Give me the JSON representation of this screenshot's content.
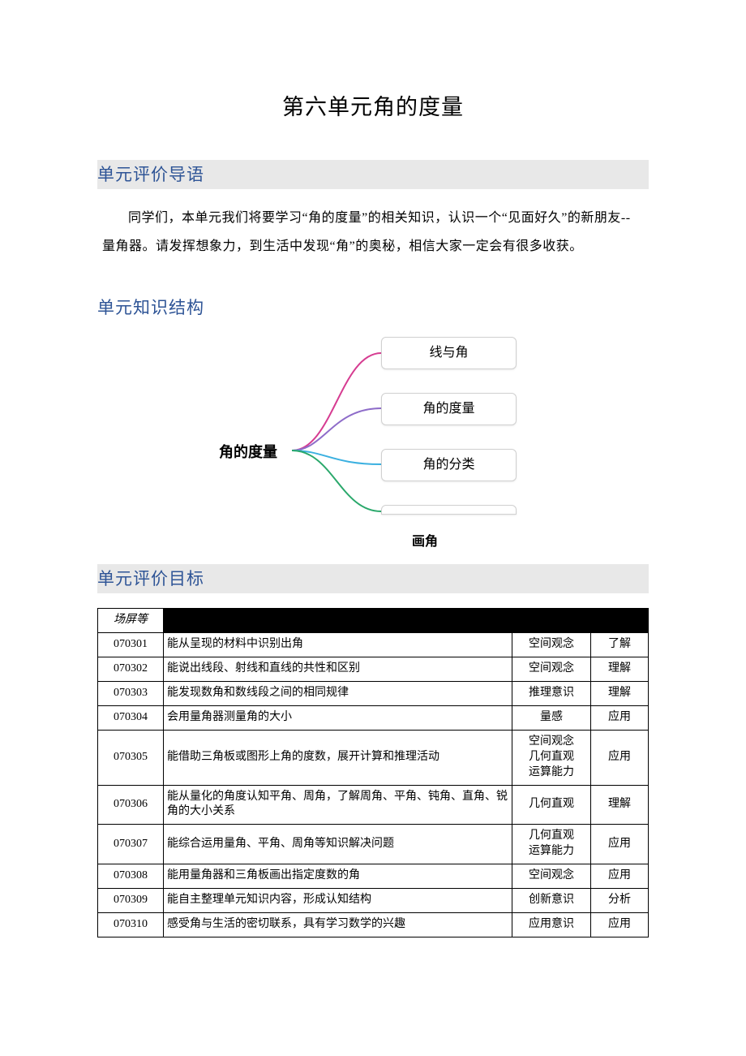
{
  "title": "第六单元角的度量",
  "sections": {
    "s1": {
      "heading": "单元评价导语"
    },
    "s2": {
      "heading": "单元知识结构"
    },
    "s3": {
      "heading": "单元评价目标"
    }
  },
  "intro": "同学们，本单元我们将要学习“角的度量”的相关知识，认识一个“见面好久”的新朋友--量角器。请发挥想象力，到生活中发现“角”的奥秘，相信大家一定会有很多收获。",
  "diagram": {
    "central": "角的度量",
    "nodes": [
      "线与角",
      "角的度量",
      "角的分类",
      "画角"
    ]
  },
  "table": {
    "headers": {
      "col1": "场屏等",
      "col2": "",
      "col3": "",
      "col4": ""
    },
    "rows": [
      {
        "code": "070301",
        "desc": "能从呈现的材料中识别出角",
        "cat": "空间观念",
        "level": "了解"
      },
      {
        "code": "070302",
        "desc": "能说出线段、射线和直线的共性和区别",
        "cat": "空间观念",
        "level": "理解"
      },
      {
        "code": "070303",
        "desc": "能发现数角和数线段之间的相同规律",
        "cat": "推理意识",
        "level": "理解"
      },
      {
        "code": "070304",
        "desc": "会用量角器测量角的大小",
        "cat": "量感",
        "level": "应用"
      },
      {
        "code": "070305",
        "desc": "能借助三角板或图形上角的度数，展开计算和推理活动",
        "cat": "空间观念\n几何直观\n运算能力",
        "level": "应用"
      },
      {
        "code": "070306",
        "desc": "能从量化的角度认知平角、周角，了解周角、平角、钝角、直角、锐角的大小关系",
        "cat": "几何直观",
        "level": "理解"
      },
      {
        "code": "070307",
        "desc": "能综合运用量角、平角、周角等知识解决问题",
        "cat": "几何直观\n运算能力",
        "level": "应用"
      },
      {
        "code": "070308",
        "desc": "能用量角器和三角板画出指定度数的角",
        "cat": "空间观念",
        "level": "应用"
      },
      {
        "code": "070309",
        "desc": "能自主整理单元知识内容，形成认知结构",
        "cat": "创新意识",
        "level": "分析"
      },
      {
        "code": "070310",
        "desc": "感受角与生活的密切联系，具有学习数学的兴趣",
        "cat": "应用意识",
        "level": "应用"
      }
    ]
  }
}
